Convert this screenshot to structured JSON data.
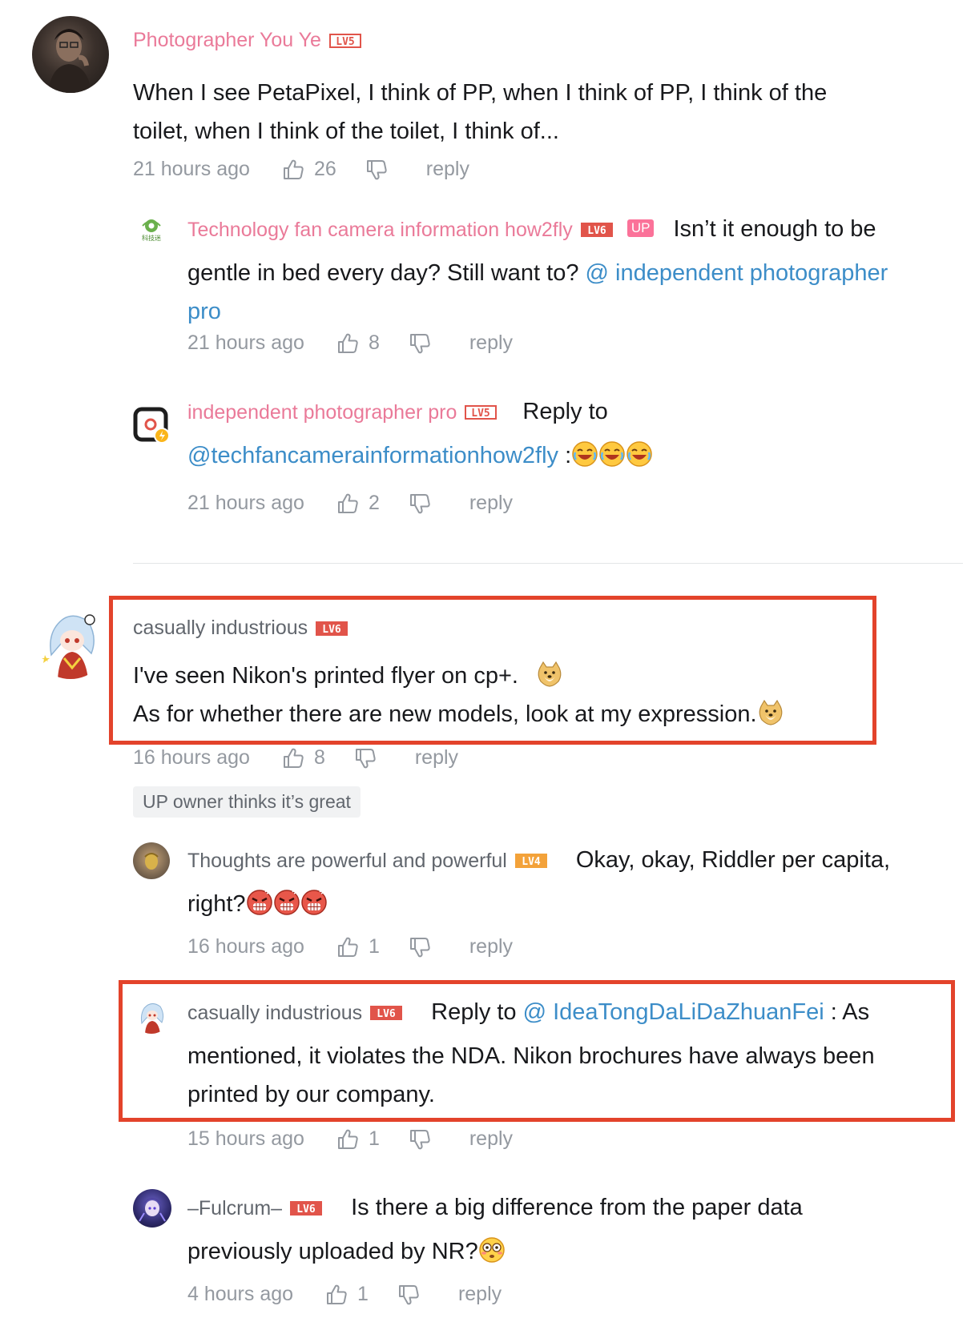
{
  "comments": [
    {
      "name": "Photographer You Ye",
      "level": "LV5",
      "body_line1": "When I see PetaPixel, I think of PP, when I think of PP, I think of the",
      "body_line2": "toilet, when I think of the toilet, I think of...",
      "time": "21 hours ago",
      "likes": "26",
      "reply": "reply"
    },
    {
      "name": "Technology fan camera information how2fly",
      "level": "LV6",
      "badge": "UP",
      "body_inline": "Isn’t it enough to be",
      "body_line2_prefix": "gentle in bed every day? Still want to? ",
      "mention": "@ independent photographer",
      "mention_line3": "pro",
      "time": "21 hours ago",
      "likes": "8",
      "reply": "reply"
    },
    {
      "name": "independent photographer pro",
      "level": "LV5",
      "body_inline": "Reply to",
      "mention": "@techfancamerainformationhow2fly",
      "suffix": " :",
      "time": "21 hours ago",
      "likes": "2",
      "reply": "reply"
    },
    {
      "name": "casually industrious",
      "level": "LV6",
      "body_line1": "I've seen Nikon's printed flyer on cp+.",
      "body_line2": "As for whether there are new models, look at my expression.",
      "time": "16 hours ago",
      "likes": "8",
      "reply": "reply",
      "up_tag": "UP owner thinks it’s great"
    },
    {
      "name": "Thoughts are powerful and powerful",
      "level": "LV4",
      "body_inline": "Okay, okay, Riddler per capita,",
      "body_line2": "right?",
      "time": "16 hours ago",
      "likes": "1",
      "reply": "reply"
    },
    {
      "name": "casually industrious",
      "level": "LV6",
      "body_inline_prefix": "Reply to ",
      "mention": "@ IdeaTongDaLiDaZhuanFei",
      "body_inline_suffix": " : As",
      "body_line2": "mentioned, it violates the NDA. Nikon brochures have always been",
      "body_line3": "printed by our company.",
      "time": "15 hours ago",
      "likes": "1",
      "reply": "reply"
    },
    {
      "name": "–Fulcrum–",
      "level": "LV6",
      "body_inline": "Is there a big difference from the paper data",
      "body_line2": "previously uploaded by NR?",
      "time": "4 hours ago",
      "likes": "1",
      "reply": "reply"
    }
  ],
  "colors": {
    "name_pink": "#ea7a99",
    "name_gray": "#61666d",
    "mention_blue": "#3c8dc8",
    "meta_gray": "#9499a0",
    "highlight_red": "#e3432b",
    "level_red": "#e1544a",
    "level_orange": "#f3a23a"
  }
}
